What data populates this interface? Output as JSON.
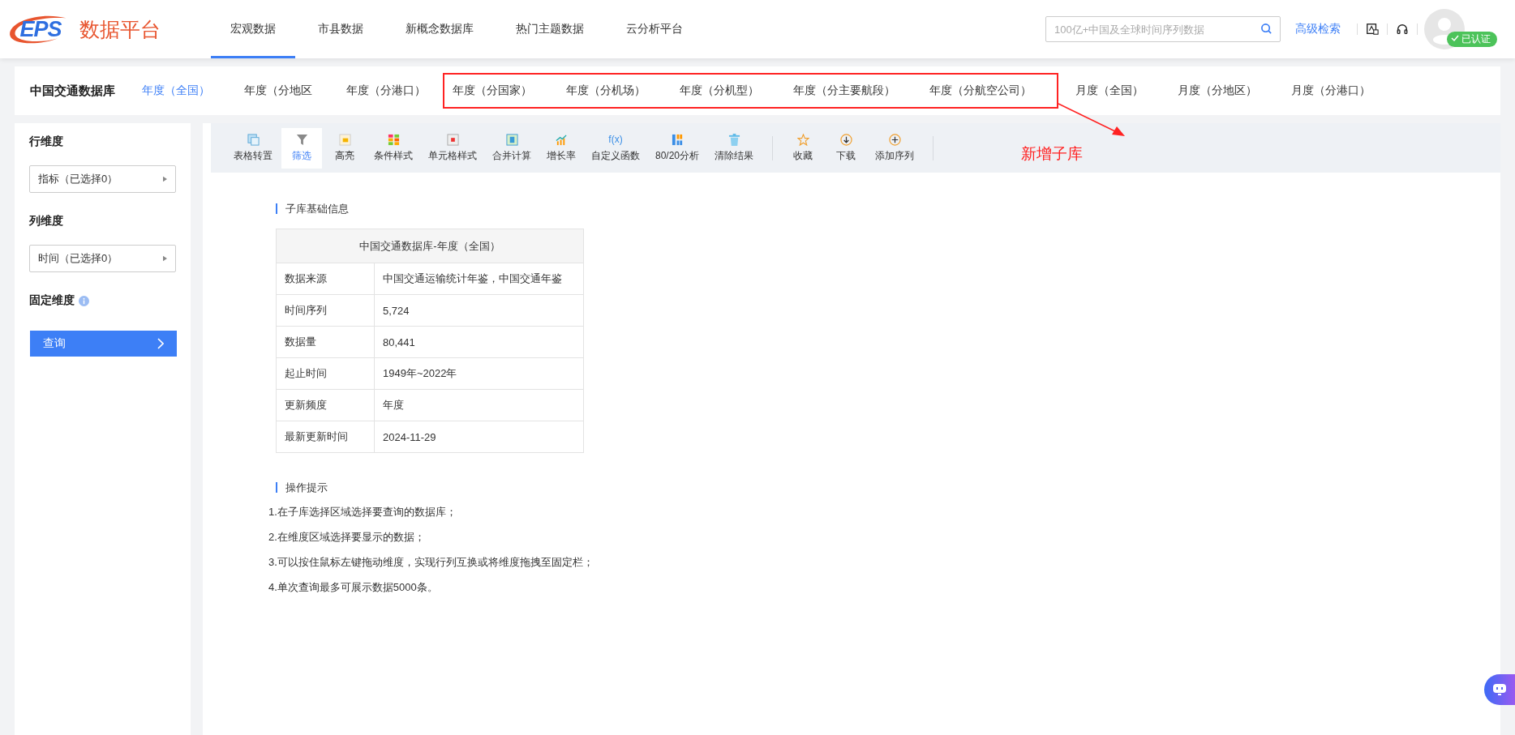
{
  "logo": {
    "mark": "EPS",
    "name": "数据平台"
  },
  "nav": [
    {
      "label": "宏观数据",
      "selected": true
    },
    {
      "label": "市县数据",
      "selected": false
    },
    {
      "label": "新概念数据库",
      "selected": false
    },
    {
      "label": "热门主题数据",
      "selected": false
    },
    {
      "label": "云分析平台",
      "selected": false
    }
  ],
  "search": {
    "placeholder": "100亿+中国及全球时间序列数据"
  },
  "advanced_search": "高级检索",
  "user": {
    "badge": "已认证"
  },
  "database": {
    "title": "中国交通数据库",
    "tab_groups": [
      {
        "annotated": false,
        "tabs": [
          {
            "label": "年度（全国）",
            "selected": true
          },
          {
            "label": "年度（分地区",
            "selected": false
          },
          {
            "label": "年度（分港口）",
            "selected": false
          }
        ]
      },
      {
        "annotated": true,
        "tabs": [
          {
            "label": "年度（分国家）",
            "selected": false
          },
          {
            "label": "年度（分机场）",
            "selected": false
          },
          {
            "label": "年度（分机型）",
            "selected": false
          },
          {
            "label": "年度（分主要航段）",
            "selected": false
          },
          {
            "label": "年度（分航空公司）",
            "selected": false
          }
        ]
      },
      {
        "annotated": false,
        "tabs": [
          {
            "label": "月度（全国）",
            "selected": false
          },
          {
            "label": "月度（分地区）",
            "selected": false
          },
          {
            "label": "月度（分港口）",
            "selected": false
          }
        ]
      }
    ]
  },
  "annotation": {
    "text": "新增子库"
  },
  "sidebar": {
    "sections": [
      {
        "kind": "select",
        "title": "行维度",
        "value": "指标（已选择0）"
      },
      {
        "kind": "select",
        "title": "列维度",
        "value": "时间（已选择0）"
      },
      {
        "kind": "info",
        "title": "固定维度"
      }
    ],
    "query_button": "查询"
  },
  "toolbar": {
    "groups": [
      [
        {
          "label": "表格转置",
          "selected": false
        },
        {
          "label": "筛选",
          "selected": true
        },
        {
          "label": "高亮",
          "selected": false
        },
        {
          "label": "条件样式",
          "selected": false
        },
        {
          "label": "单元格样式",
          "selected": false
        },
        {
          "label": "合并计算",
          "selected": false
        },
        {
          "label": "增长率",
          "selected": false
        },
        {
          "glyph": "f(x)",
          "label": "自定义函数",
          "selected": false
        },
        {
          "label": "80/20分析",
          "selected": false
        },
        {
          "label": "清除结果",
          "selected": false
        }
      ],
      [
        {
          "label": "收藏",
          "selected": false
        },
        {
          "label": "下载",
          "selected": false
        },
        {
          "label": "添加序列",
          "selected": false
        }
      ]
    ]
  },
  "info": {
    "heading": "子库基础信息",
    "table_title": "中国交通数据库-年度（全国）",
    "rows": [
      {
        "label": "数据来源",
        "value": "中国交通运输统计年鉴，中国交通年鉴"
      },
      {
        "label": "时间序列",
        "value": "5,724"
      },
      {
        "label": "数据量",
        "value": "80,441"
      },
      {
        "label": "起止时间",
        "value": "1949年~2022年"
      },
      {
        "label": "更新频度",
        "value": "年度"
      },
      {
        "label": "最新更新时间",
        "value": "2024-11-29"
      }
    ]
  },
  "tips": {
    "heading": "操作提示",
    "lines": [
      "1.在子库选择区域选择要查询的数据库；",
      "2.在维度区域选择要显示的数据；",
      "3.可以按住鼠标左键拖动维度，实现行列互换或将维度拖拽至固定栏；",
      "4.单次查询最多可展示数据5000条。"
    ]
  }
}
